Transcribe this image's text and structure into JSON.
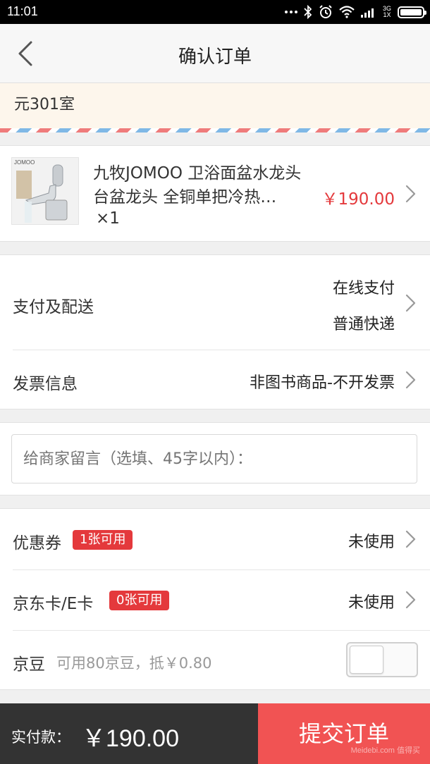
{
  "status_bar": {
    "time": "11:01",
    "network": "3G",
    "network_sub": "1X"
  },
  "header": {
    "title": "确认订单"
  },
  "address": {
    "text": "元301室"
  },
  "product": {
    "name": "九牧JOMOO 卫浴面盆水龙头 台盆龙头 全铜单把冷热…",
    "quantity": "×1",
    "price": "￥190.00",
    "brand_mark": "JOMOO"
  },
  "payment_delivery": {
    "label": "支付及配送",
    "payment_method": "在线支付",
    "delivery_method": "普通快递"
  },
  "invoice": {
    "label": "发票信息",
    "value": "非图书商品-不开发票"
  },
  "message": {
    "placeholder": "给商家留言（选填、45字以内）：",
    "value": ""
  },
  "coupon": {
    "label": "优惠券",
    "badge": "1张可用",
    "value": "未使用"
  },
  "jd_card": {
    "label": "京东卡/E卡",
    "badge": "0张可用",
    "value": "未使用"
  },
  "jd_bean": {
    "label": "京豆",
    "hint": "可用80京豆，抵￥0.80",
    "enabled": false
  },
  "footer": {
    "pay_label": "实付款：",
    "pay_amount": "￥190.00",
    "submit_label": "提交订单",
    "watermark": "Meidebi.com 值得买"
  },
  "colors": {
    "accent": "#e4393c",
    "submit_bg": "#f15353",
    "footer_bg": "#333333",
    "address_bg": "#fdf6ec"
  }
}
